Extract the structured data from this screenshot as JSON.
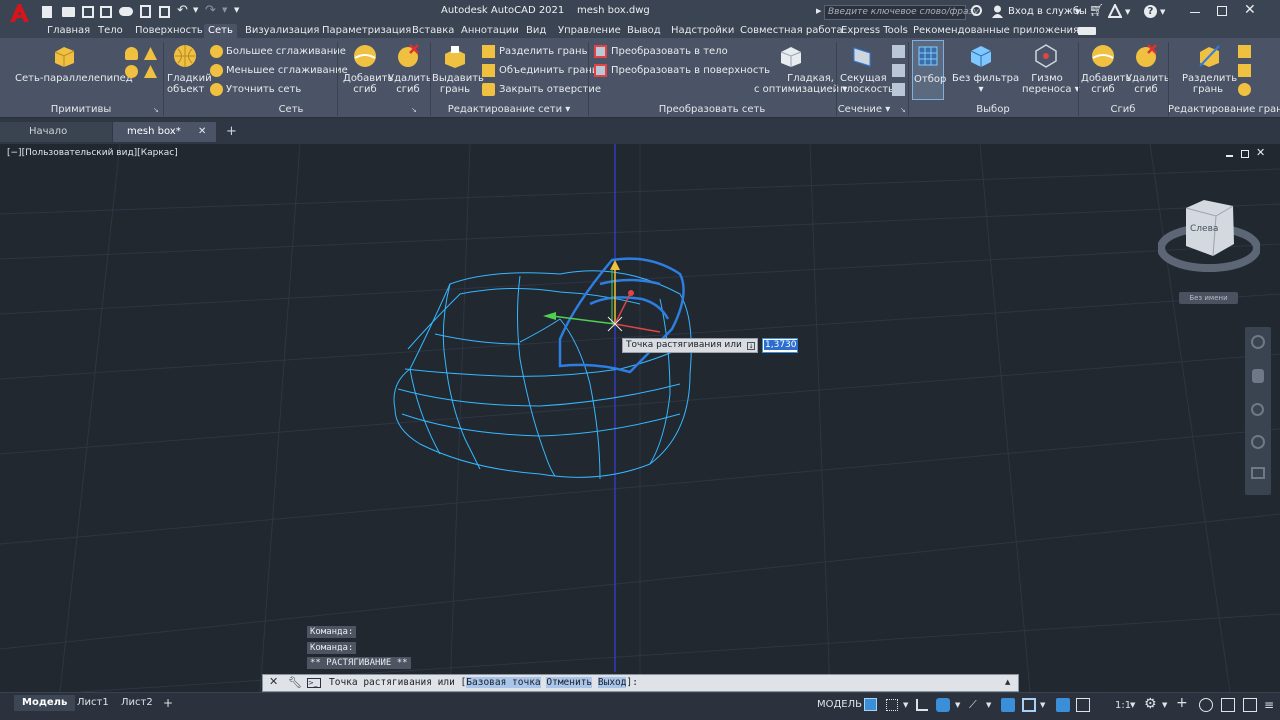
{
  "app": {
    "title": "Autodesk AutoCAD 2021",
    "file": "mesh box.dwg"
  },
  "search": {
    "placeholder": "Введите ключевое слово/фразу"
  },
  "account": {
    "signin_label": "Вход в службы"
  },
  "menu": [
    "Главная",
    "Тело",
    "Поверхность",
    "Сеть",
    "Визуализация",
    "Параметризация",
    "Вставка",
    "Аннотации",
    "Вид",
    "Управление",
    "Вывод",
    "Надстройки",
    "Совместная работа",
    "Express Tools",
    "Рекомендованные приложения"
  ],
  "ribbon": {
    "primitives": {
      "box": "Сеть-параллелепипед",
      "panel": "Примитивы"
    },
    "mesh": {
      "smooth_object_1": "Гладкий",
      "smooth_object_2": "объект",
      "more_smooth": "Большее сглаживание",
      "less_smooth": "Меньшее сглаживание",
      "refine": "Уточнить сеть",
      "add_crease_1": "Добавить",
      "add_crease_2": "сгиб",
      "remove_crease_1": "Удалить",
      "remove_crease_2": "сгиб",
      "panel": "Сеть"
    },
    "edit": {
      "extrude_1": "Выдавить",
      "extrude_2": "грань",
      "split": "Разделить грань",
      "merge": "Объединить грани",
      "close_hole": "Закрыть отверстие",
      "panel": "Редактирование сети"
    },
    "convert": {
      "to_solid": "Преобразовать в тело",
      "to_surface": "Преобразовать в поверхность",
      "smooth_1": "Гладкая,",
      "smooth_2": "с оптимизацией",
      "panel": "Преобразовать сеть"
    },
    "section": {
      "plane_1": "Секущая",
      "plane_2": "плоскость",
      "panel": "Сечение"
    },
    "selection": {
      "culling": "Отбор",
      "no_filter": "Без фильтра",
      "gizmo_1": "Гизмо",
      "gizmo_2": "переноса",
      "panel": "Выбор"
    },
    "crease": {
      "add_1": "Добавить",
      "add_2": "сгиб",
      "remove_1": "Удалить",
      "remove_2": "сгиб",
      "panel": "Сгиб"
    },
    "editface": {
      "split_1": "Разделить",
      "split_2": "грань",
      "panel": "Редактирование грань"
    }
  },
  "tabs": {
    "start": "Начало",
    "doc": "mesh box*",
    "add": "+"
  },
  "viewport": {
    "label": "[−][Пользовательский вид][Каркас]",
    "viewcube_face": "Слева",
    "named": "Без имени"
  },
  "tooltip": {
    "prompt": "Точка растягивания или",
    "value": "1,3730"
  },
  "command": {
    "history": [
      "Команда:",
      "Команда:",
      "** РАСТЯГИВАНИЕ **"
    ],
    "prompt_prefix": "Точка растягивания или [",
    "opt1": "Базовая точка",
    "opt2": "Отменить",
    "opt3": "Выход",
    "prompt_suffix": "]:"
  },
  "layouts": {
    "model": "Модель",
    "sheet1": "Лист1",
    "sheet2": "Лист2",
    "add": "+"
  },
  "status": {
    "model": "МОДЕЛЬ",
    "scale": "1:1"
  },
  "colors": {
    "accent": "#3a8fd8",
    "mesh": "#36b7ff",
    "selected": "#2e7de0",
    "logo": "#d8141b",
    "bg": "#212830"
  }
}
